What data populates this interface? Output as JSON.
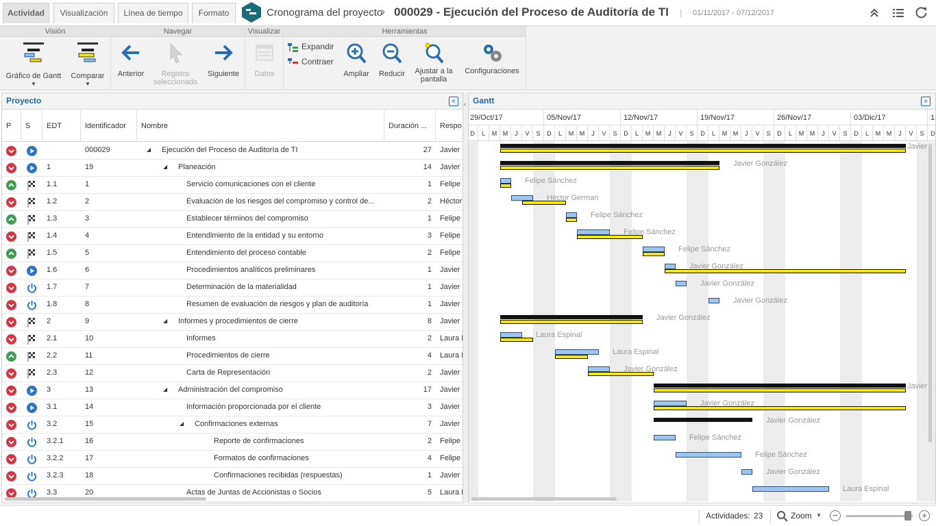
{
  "tabs": [
    "Actividad",
    "Visualización",
    "Línea de tiempo",
    "Formato"
  ],
  "header": {
    "app_title": "Cronograma del proyecto",
    "separator": "›",
    "project_title": "000029 - Ejecución del Proceso de Auditoría de TI",
    "pipe": "|",
    "dates": "01/11/2017 - 07/12/2017"
  },
  "ribbon": {
    "groups": [
      "Visión",
      "Navegar",
      "Visualizar",
      "Herramientas"
    ],
    "vision": {
      "gantt": "Gráfico de Gantt",
      "compare": "Comparar"
    },
    "navegar": {
      "prev": "Anterior",
      "selected_l1": "Registro",
      "selected_l2": "seleccionado",
      "next": "Siguiente"
    },
    "visualizar": {
      "data": "Datos"
    },
    "herramientas": {
      "expand": "Expandir",
      "collapse": "Contraer",
      "zoom_in": "Ampliar",
      "zoom_out": "Reducir",
      "fit_l1": "Ajustar a la",
      "fit_l2": "pantalla",
      "settings": "Configuraciones"
    }
  },
  "left_panel": {
    "title": "Proyecto",
    "collapse_glyph": "«",
    "columns": [
      "P",
      "S",
      "EDT",
      "Identificador",
      "Nombre",
      "Duración ...",
      "Respo"
    ]
  },
  "rows": [
    {
      "p": "down",
      "s": "play",
      "edt": "",
      "id": "000029",
      "name": "Ejecución del Proceso de Auditoría de TI",
      "level": 0,
      "exp": true,
      "dur": "27",
      "resp": "Javier G"
    },
    {
      "p": "down",
      "s": "play",
      "edt": "1",
      "id": "19",
      "name": "Planeación",
      "level": 1,
      "exp": true,
      "dur": "14",
      "resp": "Javier G"
    },
    {
      "p": "up",
      "s": "flag",
      "edt": "1.1",
      "id": "1",
      "name": "Servicio comunicaciones con el cliente",
      "level": 2,
      "exp": false,
      "dur": "1",
      "resp": "Felipe S"
    },
    {
      "p": "down",
      "s": "flag",
      "edt": "1.2",
      "id": "2",
      "name": "Evaluación de los riesgos del compromiso y control de...",
      "level": 2,
      "exp": false,
      "dur": "2",
      "resp": "Héctor G"
    },
    {
      "p": "up",
      "s": "flag",
      "edt": "1.3",
      "id": "3",
      "name": "Establecer términos del compromiso",
      "level": 2,
      "exp": false,
      "dur": "1",
      "resp": "Felipe S"
    },
    {
      "p": "down",
      "s": "flag",
      "edt": "1.4",
      "id": "4",
      "name": "Entendimiento de la entidad y su entorno",
      "level": 2,
      "exp": false,
      "dur": "3",
      "resp": "Felipe S"
    },
    {
      "p": "up",
      "s": "flag",
      "edt": "1.5",
      "id": "5",
      "name": "Entendimiento del proceso contable",
      "level": 2,
      "exp": false,
      "dur": "2",
      "resp": "Felipe S"
    },
    {
      "p": "down",
      "s": "play",
      "edt": "1.6",
      "id": "6",
      "name": "Procedimientos analíticos preliminares",
      "level": 2,
      "exp": false,
      "dur": "1",
      "resp": "Javier G"
    },
    {
      "p": "down",
      "s": "power",
      "edt": "1.7",
      "id": "7",
      "name": "Determinación de la materialidad",
      "level": 2,
      "exp": false,
      "dur": "1",
      "resp": "Javier G"
    },
    {
      "p": "down",
      "s": "power",
      "edt": "1.8",
      "id": "8",
      "name": "Resumen de evaluación de riesgos y plan de auditoría",
      "level": 2,
      "exp": false,
      "dur": "1",
      "resp": "Javier G"
    },
    {
      "p": "down",
      "s": "flag",
      "edt": "2",
      "id": "9",
      "name": "Informes y procedimientos de cierre",
      "level": 1,
      "exp": true,
      "dur": "8",
      "resp": "Javier G"
    },
    {
      "p": "down",
      "s": "flag",
      "edt": "2.1",
      "id": "10",
      "name": "Informes",
      "level": 2,
      "exp": false,
      "dur": "2",
      "resp": "Laura E"
    },
    {
      "p": "up",
      "s": "flag",
      "edt": "2.2",
      "id": "11",
      "name": "Procedimientos de cierre",
      "level": 2,
      "exp": false,
      "dur": "4",
      "resp": "Laura E"
    },
    {
      "p": "down",
      "s": "flag",
      "edt": "2.3",
      "id": "12",
      "name": "Carta de Representación",
      "level": 2,
      "exp": false,
      "dur": "2",
      "resp": "Javier G"
    },
    {
      "p": "down",
      "s": "play",
      "edt": "3",
      "id": "13",
      "name": "Administración del compromiso",
      "level": 1,
      "exp": true,
      "dur": "17",
      "resp": "Javier G"
    },
    {
      "p": "down",
      "s": "play",
      "edt": "3.1",
      "id": "14",
      "name": "Información proporcionada por el cliente",
      "level": 2,
      "exp": false,
      "dur": "3",
      "resp": "Javier G"
    },
    {
      "p": "down",
      "s": "power",
      "edt": "3.2",
      "id": "15",
      "name": "Confirmaciones externas",
      "level": 2,
      "exp": true,
      "dur": "7",
      "resp": "Javier G"
    },
    {
      "p": "down",
      "s": "power",
      "edt": "3.2.1",
      "id": "16",
      "name": "Reporte de confirmaciones",
      "level": 3,
      "exp": false,
      "dur": "2",
      "resp": "Felipe S"
    },
    {
      "p": "down",
      "s": "power",
      "edt": "3.2.2",
      "id": "17",
      "name": "Formatos de confirmaciones",
      "level": 3,
      "exp": false,
      "dur": "4",
      "resp": "Felipe S"
    },
    {
      "p": "down",
      "s": "power",
      "edt": "3.2.3",
      "id": "18",
      "name": "Confirmaciones recibidas (respuestas)",
      "level": 3,
      "exp": false,
      "dur": "1",
      "resp": "Javier G"
    },
    {
      "p": "down",
      "s": "power",
      "edt": "3.3",
      "id": "20",
      "name": "Actas de Juntas de Accionistas o Socios",
      "level": 2,
      "exp": false,
      "dur": "5",
      "resp": "Laura E"
    }
  ],
  "gantt": {
    "title": "Gantt",
    "expand_glyph": "»",
    "weeks": [
      "29/Oct/17",
      "05/Nov/17",
      "12/Nov/17",
      "19/Nov/17",
      "26/Nov/17",
      "03/Dic/17",
      "1"
    ],
    "day_letters": [
      "D",
      "L",
      "M",
      "M",
      "J",
      "V",
      "S"
    ],
    "bars": [
      {
        "label": "Javier",
        "summary": true,
        "blue_start": null,
        "blue_end": null,
        "plan_start": 3,
        "plan_end": 40
      },
      {
        "label": "Javier González",
        "summary": true,
        "plan_start": 3,
        "plan_end": 23
      },
      {
        "label": "Felipe Sánchez",
        "summary": false,
        "blue_start": 3,
        "blue_end": 4,
        "plan_start": 3,
        "plan_end": 4
      },
      {
        "label": "Héctor German",
        "summary": false,
        "blue_start": 4,
        "blue_end": 6,
        "plan_start": 5,
        "plan_end": 9
      },
      {
        "label": "Felipe Sánchez",
        "summary": false,
        "blue_start": 9,
        "blue_end": 10,
        "plan_start": 9,
        "plan_end": 10
      },
      {
        "label": "Felipe Sánchez",
        "summary": false,
        "blue_start": 10,
        "blue_end": 13,
        "plan_start": 10,
        "plan_end": 16
      },
      {
        "label": "Felipe Sánchez",
        "summary": false,
        "blue_start": 16,
        "blue_end": 18,
        "plan_start": 16,
        "plan_end": 18
      },
      {
        "label": "Javier González",
        "summary": false,
        "blue_start": 18,
        "blue_end": 19,
        "plan_start": 18,
        "plan_end": 40
      },
      {
        "label": "Javier González",
        "summary": false,
        "blue_start": 19,
        "blue_end": 20,
        "plan_start": null,
        "plan_end": null
      },
      {
        "label": "Javier González",
        "summary": false,
        "blue_start": 22,
        "blue_end": 23,
        "plan_start": null,
        "plan_end": null
      },
      {
        "label": "Javier González",
        "summary": true,
        "plan_start": 3,
        "plan_end": 16
      },
      {
        "label": "Laura Espinal",
        "summary": false,
        "blue_start": 3,
        "blue_end": 5,
        "plan_start": 3,
        "plan_end": 6
      },
      {
        "label": "Laura Espinal",
        "summary": false,
        "blue_start": 8,
        "blue_end": 12,
        "plan_start": 8,
        "plan_end": 11
      },
      {
        "label": "Javier González",
        "summary": false,
        "blue_start": 11,
        "blue_end": 13,
        "plan_start": 11,
        "plan_end": 17
      },
      {
        "label": "Javier",
        "summary": true,
        "plan_start": 17,
        "plan_end": 40
      },
      {
        "label": "Javier González",
        "summary": false,
        "blue_start": 17,
        "blue_end": 20,
        "plan_start": 17,
        "plan_end": 40
      },
      {
        "label": "Javier González",
        "summary": true,
        "blue_only": true,
        "plan_start": 17,
        "plan_end": 26
      },
      {
        "label": "Felipe Sánchez",
        "summary": false,
        "blue_start": 17,
        "blue_end": 19,
        "plan_start": null,
        "plan_end": null
      },
      {
        "label": "Felipe Sánchez",
        "summary": false,
        "blue_start": 19,
        "blue_end": 25,
        "plan_start": null,
        "plan_end": null
      },
      {
        "label": "Javier González",
        "summary": false,
        "blue_start": 25,
        "blue_end": 26,
        "plan_start": null,
        "plan_end": null
      },
      {
        "label": "Laura Espinal",
        "summary": false,
        "blue_start": 26,
        "blue_end": 33,
        "plan_start": null,
        "plan_end": null
      }
    ]
  },
  "status": {
    "activities_label": "Actividades:",
    "activities_count": "23",
    "zoom_label": "Zoom"
  }
}
